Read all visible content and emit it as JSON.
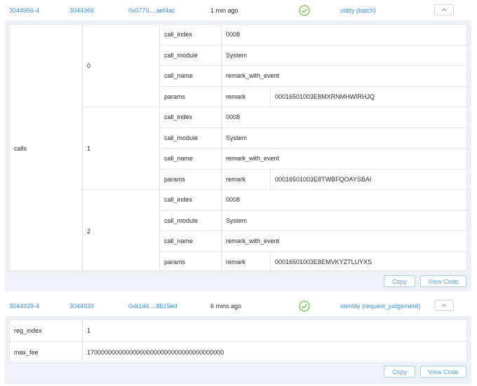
{
  "extrinsics": [
    {
      "id": "3044966-4",
      "block": "3044966",
      "hash": "0x0770....aef4ac",
      "time": "1 min ago",
      "status_icon": "success-check-icon",
      "action": "utility (batch)",
      "toggle_icon": "chevron-up-icon",
      "params": {
        "label": "calls",
        "calls": [
          {
            "index": "0",
            "fields": [
              {
                "key": "call_index",
                "value": "0008"
              },
              {
                "key": "call_module",
                "value": "System"
              },
              {
                "key": "call_name",
                "value": "remark_with_event"
              },
              {
                "key": "params",
                "sub_key": "remark",
                "value": "00016501003E8MXRNMHWIRHJQ"
              }
            ]
          },
          {
            "index": "1",
            "fields": [
              {
                "key": "call_index",
                "value": "0008"
              },
              {
                "key": "call_module",
                "value": "System"
              },
              {
                "key": "call_name",
                "value": "remark_with_event"
              },
              {
                "key": "params",
                "sub_key": "remark",
                "value": "00016501003E8TWBFQOAYSBAI"
              }
            ]
          },
          {
            "index": "2",
            "fields": [
              {
                "key": "call_index",
                "value": "0008"
              },
              {
                "key": "call_module",
                "value": "System"
              },
              {
                "key": "call_name",
                "value": "remark_with_event"
              },
              {
                "key": "params",
                "sub_key": "remark",
                "value": "00016501003E8EMVKYZTLUYXS"
              }
            ]
          }
        ]
      },
      "copy_label": "Copy",
      "view_code_label": "View Code"
    },
    {
      "id": "3044939-4",
      "block": "3044939",
      "hash": "0xb1d4....8b15ed",
      "time": "6 mins ago",
      "status_icon": "success-check-icon",
      "action": "identity (request_judgement)",
      "toggle_icon": "chevron-up-icon",
      "params": {
        "rows": [
          {
            "key": "reg_index",
            "value": "1"
          },
          {
            "key": "max_fee",
            "value": "170000000000000000000000000000000000000"
          }
        ]
      },
      "copy_label": "Copy",
      "view_code_label": "View Code"
    }
  ],
  "colors": {
    "link": "#3a8fd3",
    "success": "#6bbf4a",
    "panel_bg": "#eef1f5",
    "button_border": "#a9cfee"
  }
}
